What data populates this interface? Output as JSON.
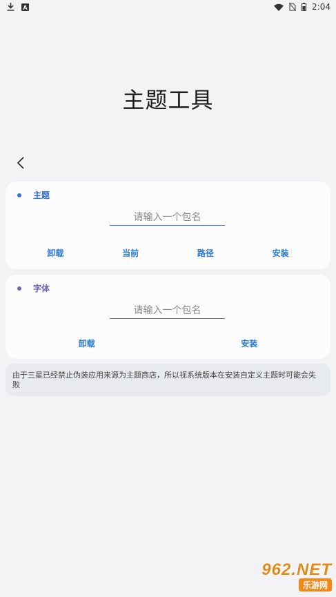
{
  "status_bar": {
    "time": "2:04",
    "icons": [
      "download-icon",
      "a-badge-icon",
      "wifi-icon",
      "no-sim-icon",
      "battery-icon"
    ]
  },
  "app": {
    "title": "主题工具"
  },
  "theme_card": {
    "label": "主题",
    "input_placeholder": "请输入一个包名",
    "buttons": [
      "卸载",
      "当前",
      "路径",
      "安装"
    ]
  },
  "font_card": {
    "label": "字体",
    "input_placeholder": "请输入一个包名",
    "buttons": [
      "卸载",
      "安装"
    ]
  },
  "notice": {
    "text": "由于三星已经禁止伪装应用来源为主题商店，所以视系统版本在安装自定义主题时可能会失败"
  },
  "watermark": {
    "top": "962.NET",
    "bottom": "乐游网"
  },
  "colors": {
    "accent_blue": "#2f6bd8",
    "accent_purple": "#6a60b0",
    "button_text": "#2a7bd0",
    "background": "#f3f3f5"
  }
}
